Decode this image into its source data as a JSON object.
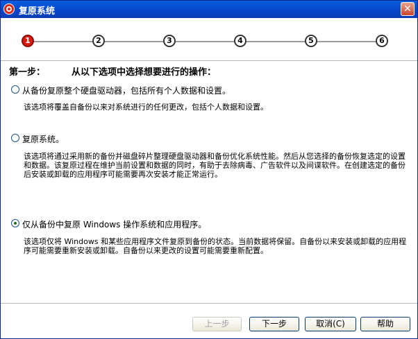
{
  "window": {
    "title": "复原系统",
    "close_symbol": "✕"
  },
  "steps": [
    "1",
    "2",
    "3",
    "4",
    "5",
    "6"
  ],
  "active_step": 1,
  "heading": {
    "step": "第一步：",
    "instruction": "从以下选项中选择想要进行的操作："
  },
  "options": [
    {
      "label": "从备份复原整个硬盘驱动器，包括所有个人数据和设置。",
      "checked": false,
      "desc": "该选项将覆盖自备份以来对系统进行的任何更改，包括个人数据和设置。"
    },
    {
      "label": "复原系统。",
      "checked": false,
      "desc": "该选项将通过采用新的备份并磁盘碎片整理硬盘驱动器和备份优化系统性能。然后从您选择的备份恢复选定的设置和数据。该复原过程在维护当前设置和数据的同时，有助于去除病毒、广告软件以及间谍软件。在创建选定的备份后安装或卸载的应用程序可能需要再次安装才能正常运行。"
    },
    {
      "label": "仅从备份中复原 Windows 操作系统和应用程序。",
      "checked": true,
      "desc": "该选项仅将 Windows 和某些应用程序文件复原到备份的状态。当前数据将保留。自备份以来安装或卸载的应用程序可能需要重新安装或卸载。自备份以来更改的设置可能需要重新配置。"
    }
  ],
  "buttons": {
    "back": "上一步",
    "next": "下一步",
    "cancel": "取消(C)",
    "help": "帮助"
  },
  "colors": {
    "titlebar": "#0846c8",
    "active_step": "#d91c0f"
  }
}
